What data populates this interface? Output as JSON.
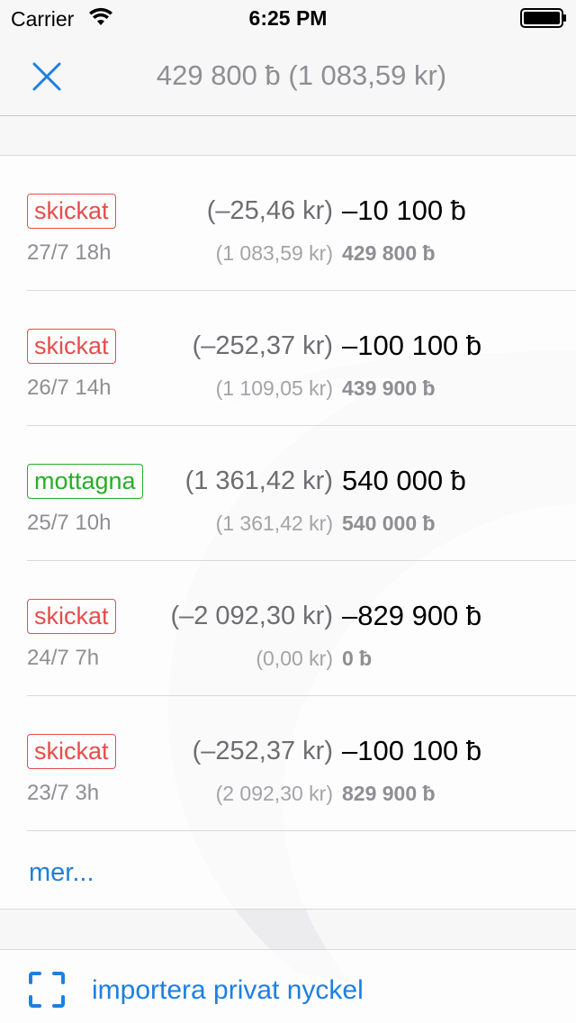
{
  "status_bar": {
    "carrier": "Carrier",
    "time": "6:25 PM",
    "wifi_icon": "wifi-icon",
    "battery_icon": "battery-icon"
  },
  "nav": {
    "close_icon": "close-icon",
    "title": "429 800 ƀ (1 083,59 kr)"
  },
  "transactions": [
    {
      "status": "skickat",
      "status_type": "sent",
      "date": "27/7 18h",
      "fiat_change": "(–25,46 kr)",
      "amount": "–10 100 ƀ",
      "fiat_balance": "(1 083,59 kr)",
      "balance": "429 800 ƀ"
    },
    {
      "status": "skickat",
      "status_type": "sent",
      "date": "26/7 14h",
      "fiat_change": "(–252,37 kr)",
      "amount": "–100 100 ƀ",
      "fiat_balance": "(1 109,05 kr)",
      "balance": "439 900 ƀ"
    },
    {
      "status": "mottagna",
      "status_type": "received",
      "date": "25/7 10h",
      "fiat_change": "(1 361,42 kr)",
      "amount": "540 000 ƀ",
      "fiat_balance": "(1 361,42 kr)",
      "balance": "540 000 ƀ"
    },
    {
      "status": "skickat",
      "status_type": "sent",
      "date": "24/7 7h",
      "fiat_change": "(–2 092,30 kr)",
      "amount": "–829 900 ƀ",
      "fiat_balance": "(0,00 kr)",
      "balance": "0 ƀ"
    },
    {
      "status": "skickat",
      "status_type": "sent",
      "date": "23/7 3h",
      "fiat_change": "(–252,37 kr)",
      "amount": "–100 100 ƀ",
      "fiat_balance": "(2 092,30 kr)",
      "balance": "829 900 ƀ"
    }
  ],
  "more_label": "mer...",
  "import": {
    "icon": "scan-icon",
    "label": "importera privat nyckel"
  },
  "colors": {
    "accent": "#1e7fe0",
    "sent": "#e74c4c",
    "received": "#27ae27"
  }
}
